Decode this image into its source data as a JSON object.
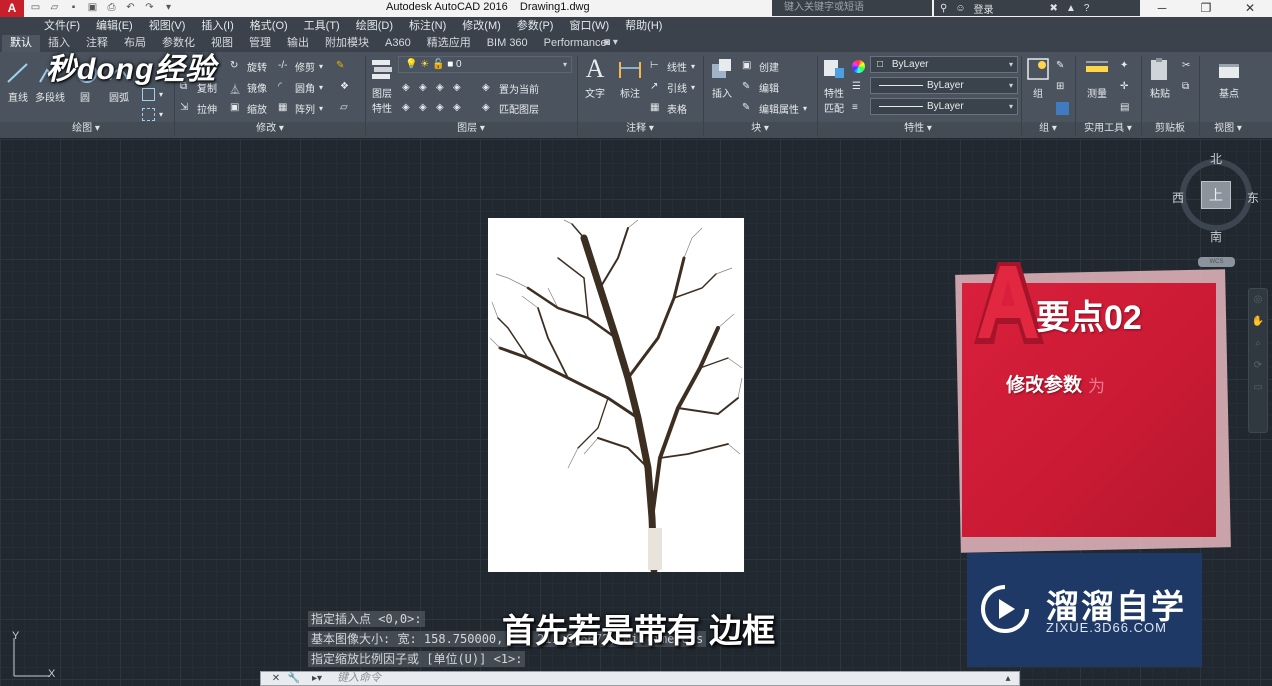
{
  "window": {
    "title": "Autodesk AutoCAD 2016    Drawing1.dwg",
    "search_placeholder": "键入关键字或短语",
    "login_label": "登录",
    "app_logo": "A"
  },
  "menu": [
    "文件(F)",
    "编辑(E)",
    "视图(V)",
    "插入(I)",
    "格式(O)",
    "工具(T)",
    "绘图(D)",
    "标注(N)",
    "修改(M)",
    "参数(P)",
    "窗口(W)",
    "帮助(H)"
  ],
  "ribbon_tabs": [
    "默认",
    "插入",
    "注释",
    "布局",
    "参数化",
    "视图",
    "管理",
    "输出",
    "附加模块",
    "A360",
    "精选应用",
    "BIM 360",
    "Performance"
  ],
  "active_tab": "默认",
  "ribbon": {
    "draw": {
      "line": "直线",
      "polyline": "多段线",
      "circle": "圆",
      "arc": "圆弧",
      "panel": "绘图"
    },
    "modify": {
      "rotate": "旋转",
      "trim": "修剪",
      "copy": "复制",
      "mirror": "镜像",
      "fillet": "圆角",
      "stretch": "拉伸",
      "scale": "缩放",
      "array": "阵列",
      "panel": "修改"
    },
    "layers": {
      "layer_properties": "图层特性",
      "layer_properties_line1": "图层",
      "layer_properties_line2": "特性",
      "current_layer": "0",
      "make_current": "置为当前",
      "match_layer": "匹配图层",
      "panel": "图层"
    },
    "annotation": {
      "text": "文字",
      "dimension": "标注",
      "linear": "线性",
      "leader": "引线",
      "table": "表格",
      "panel": "注释"
    },
    "block": {
      "insert": "插入",
      "create": "创建",
      "edit": "编辑",
      "edit_attributes": "编辑属性",
      "panel": "块"
    },
    "properties": {
      "match_line1": "特性",
      "match_line2": "匹配",
      "color": "ByLayer",
      "linetype": "ByLayer",
      "lineweight": "ByLayer",
      "panel": "特性"
    },
    "groups": {
      "group": "组",
      "panel": "组"
    },
    "utilities": {
      "measure": "测量",
      "panel": "实用工具"
    },
    "clipboard": {
      "paste": "粘贴",
      "panel": "剪贴板"
    },
    "view": {
      "base": "基点",
      "panel": "视图"
    }
  },
  "viewcube": {
    "north": "北",
    "south": "南",
    "east": "东",
    "west": "西",
    "face": "上",
    "wcs": "WCS"
  },
  "overlay": {
    "watermark": "秒dong经验",
    "card_title": "要点02",
    "card_subtitle": "修改参数",
    "card_subtitle_ghost": "为",
    "brand_name": "溜溜自学",
    "brand_url": "ZIXUE.3D66.COM",
    "subtitle": "首先若是带有 边框"
  },
  "command_history": [
    "指定插入点 <0,0>:",
    "基本图像大小: 宽: 158.750000, 高: 211.666672, Millimeters",
    "指定缩放比例因子或 [单位(U)] <1>:"
  ],
  "command_input_placeholder": "键入命令",
  "ucs": {
    "x": "X",
    "y": "Y"
  },
  "colors": {
    "canvas": "#212830",
    "ribbon": "#4a535e",
    "card_red": "#d91f3c",
    "brand_blue": "#1f3966",
    "accent": "#c8202a"
  }
}
